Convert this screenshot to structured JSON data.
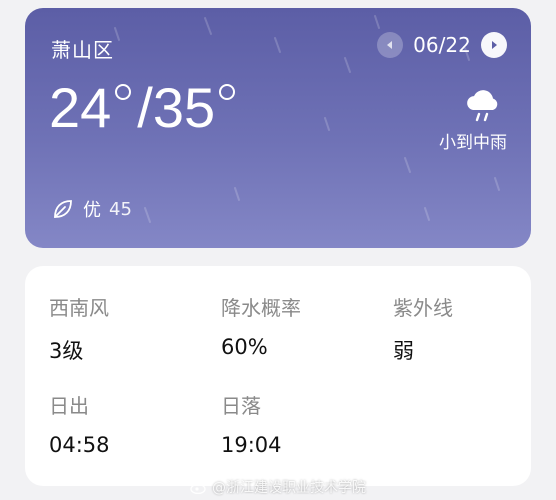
{
  "weather": {
    "city": "萧山区",
    "date": "06/22",
    "temp_low": "24",
    "temp_sep": "/",
    "temp_high": "35",
    "condition": "小到中雨",
    "condition_icon": "cloud-rain-icon",
    "aqi_label": "优",
    "aqi_value": "45"
  },
  "details": [
    {
      "label": "西南风",
      "value": "3级"
    },
    {
      "label": "降水概率",
      "value": "60%"
    },
    {
      "label": "紫外线",
      "value": "弱"
    },
    {
      "label": "日出",
      "value": "04:58"
    },
    {
      "label": "日落",
      "value": "19:04"
    }
  ],
  "watermark": "@浙江建设职业技术学院",
  "colors": {
    "card_top": "#5c5ea6",
    "card_bottom": "#8487c6",
    "page_bg": "#f2f2f4"
  }
}
